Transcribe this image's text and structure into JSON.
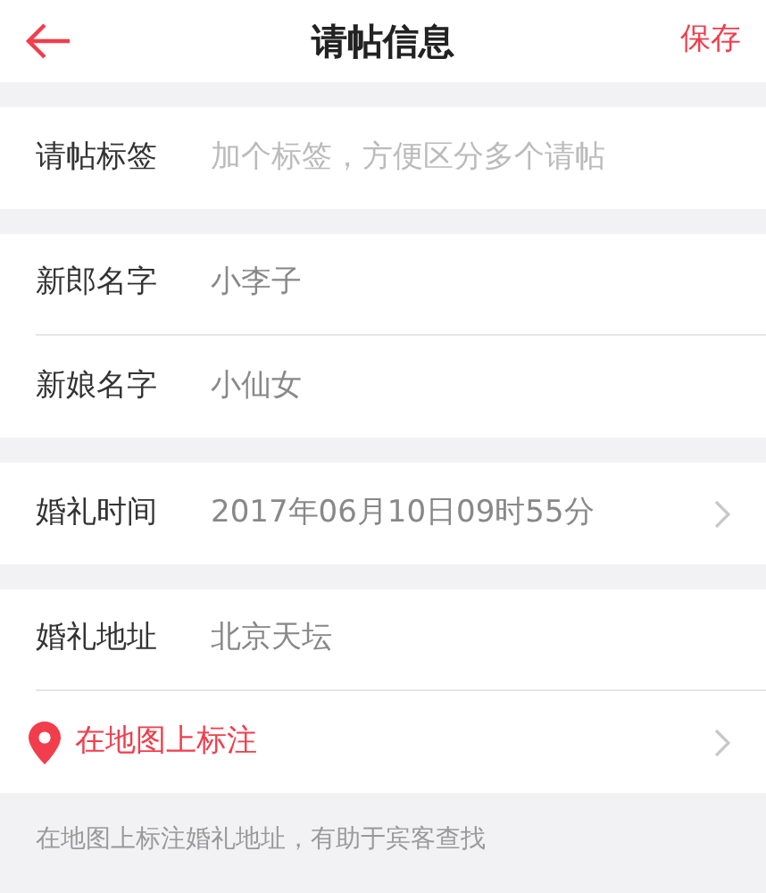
{
  "header": {
    "title": "请帖信息",
    "action": "保存"
  },
  "sections": [
    {
      "rows": [
        {
          "kind": "field",
          "label": "请帖标签",
          "placeholder": "加个标签，方便区分多个请帖"
        }
      ]
    },
    {
      "rows": [
        {
          "kind": "field",
          "label": "新郎名字",
          "value": "小李子"
        },
        {
          "kind": "field",
          "label": "新娘名字",
          "value": "小仙女"
        }
      ]
    },
    {
      "rows": [
        {
          "kind": "select",
          "label": "婚礼时间",
          "value": "2017年06月10日09时55分"
        }
      ]
    },
    {
      "rows": [
        {
          "kind": "field",
          "label": "婚礼地址",
          "value": "北京天坛"
        },
        {
          "kind": "link",
          "label": "在地图上标注"
        }
      ]
    }
  ],
  "hint": "在地图上标注婚礼地址，有助于宾客查找"
}
